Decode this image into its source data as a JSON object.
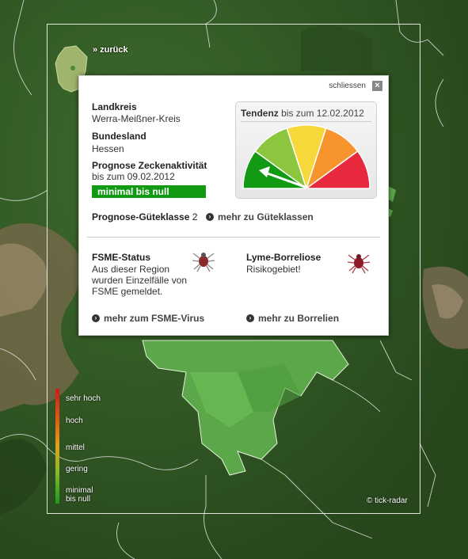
{
  "nav": {
    "back_label": "» zurück"
  },
  "popup": {
    "close_label": "schliessen",
    "close_icon": "×",
    "landkreis_label": "Landkreis",
    "landkreis_value": "Werra-Meißner-Kreis",
    "bundesland_label": "Bundesland",
    "bundesland_value": "Hessen",
    "prognose_label": "Prognose Zeckenaktivität",
    "prognose_until": "bis zum 09.02.2012",
    "status_label": "minimal bis null",
    "status_color": "#129a14",
    "gauge": {
      "title_bold": "Tendenz",
      "title_rest": " bis zum 12.02.2012",
      "level": 0,
      "segment_colors": [
        "#129a14",
        "#8cc63f",
        "#f7d83a",
        "#f7942d",
        "#e8283c"
      ]
    },
    "gueteklasse_label": "Prognose-Güteklasse",
    "gueteklasse_value": "2",
    "gueteklasse_link": "mehr zu Güteklassen",
    "fsme_title": "FSME-Status",
    "fsme_text_1": "Aus dieser Region",
    "fsme_text_2": "wurden Einzelfälle von",
    "fsme_text_3": "FSME gemeldet.",
    "fsme_link": "mehr zum FSME-Virus",
    "lyme_title": "Lyme-Borreliose",
    "lyme_text": "Risikogebiet!",
    "lyme_link": "mehr zu Borrelien"
  },
  "legend": {
    "items": [
      "sehr hoch",
      "hoch",
      "mittel",
      "gering",
      "minimal",
      "bis null"
    ]
  },
  "copyright": "© tick-radar"
}
